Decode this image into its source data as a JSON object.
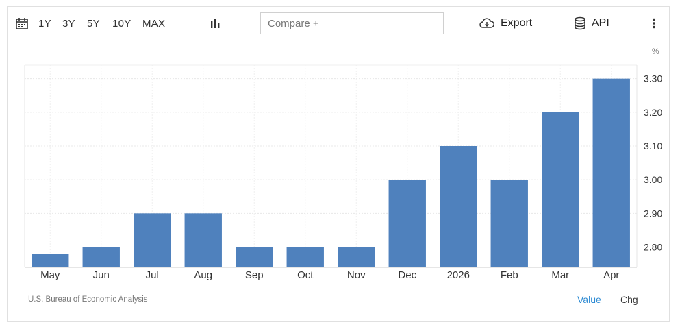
{
  "toolbar": {
    "ranges": [
      "1Y",
      "3Y",
      "5Y",
      "10Y",
      "MAX"
    ],
    "compare_placeholder": "Compare +",
    "export_label": "Export",
    "api_label": "API"
  },
  "footer": {
    "source": "U.S. Bureau of Economic Analysis",
    "toggle_value": "Value",
    "toggle_chg": "Chg"
  },
  "colors": {
    "bar": "#4f81bd",
    "accent": "#2e8bd3"
  },
  "chart_data": {
    "type": "bar",
    "unit": "%",
    "categories": [
      "May",
      "Jun",
      "Jul",
      "Aug",
      "Sep",
      "Oct",
      "Nov",
      "Dec",
      "2026",
      "Feb",
      "Mar",
      "Apr"
    ],
    "values": [
      2.78,
      2.8,
      2.9,
      2.9,
      2.8,
      2.8,
      2.8,
      3.0,
      3.1,
      3.0,
      3.2,
      3.3
    ],
    "y_ticks": [
      "2.80",
      "2.90",
      "3.00",
      "3.10",
      "3.20",
      "3.30"
    ],
    "ylim": [
      2.74,
      3.34
    ],
    "grid": true,
    "y_axis_side": "right"
  }
}
